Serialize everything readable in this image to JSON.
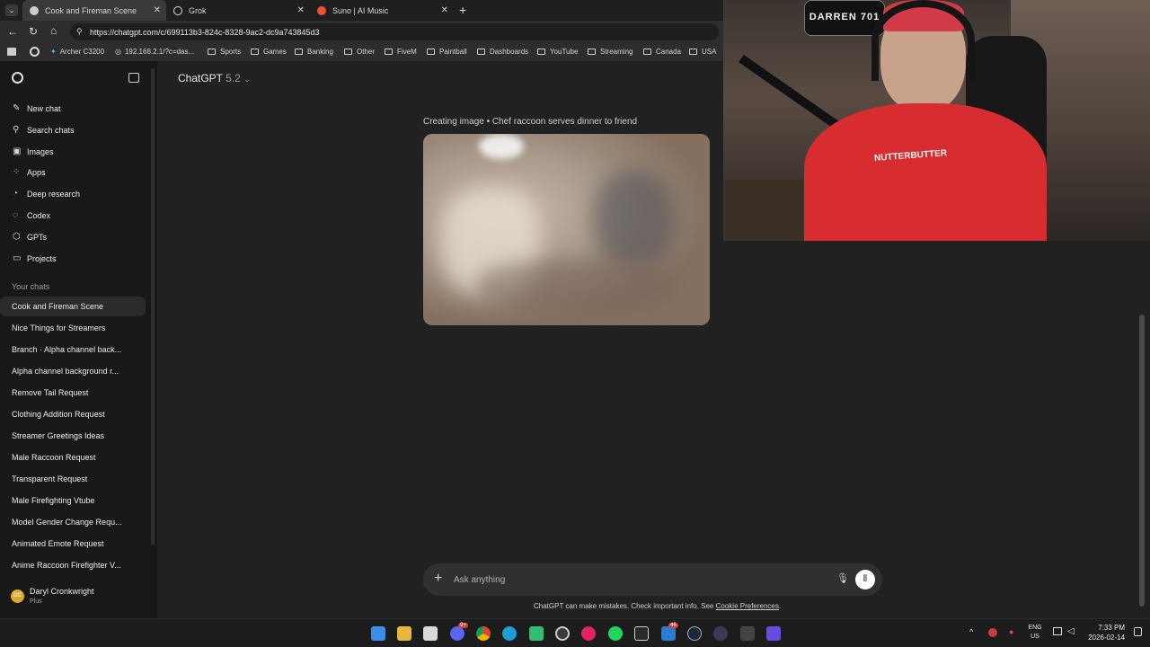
{
  "tabs": [
    {
      "title": "Cook and Fireman Scene",
      "active": true
    },
    {
      "title": "Grok",
      "active": false
    },
    {
      "title": "Suno | AI Music",
      "active": false
    }
  ],
  "address": {
    "url": "https://chatgpt.com/c/699113b3-824c-8328-9ac2-dc9a743845d3"
  },
  "bookmarks": [
    "Archer C3200",
    "192.168.2.1/?c=das...",
    "Sports",
    "Games",
    "Banking",
    "Other",
    "FiveM",
    "Paintball",
    "Dashboards",
    "YouTube",
    "Streaming",
    "Canada",
    "USA"
  ],
  "sidebar": {
    "nav": [
      {
        "label": "New chat",
        "icon": "edit-icon"
      },
      {
        "label": "Search chats",
        "icon": "search-icon"
      },
      {
        "label": "Images",
        "icon": "image-icon"
      },
      {
        "label": "Apps",
        "icon": "apps-icon"
      },
      {
        "label": "Deep research",
        "icon": "research-icon"
      },
      {
        "label": "Codex",
        "icon": "codex-icon"
      },
      {
        "label": "GPTs",
        "icon": "gpts-icon"
      },
      {
        "label": "Projects",
        "icon": "folder-icon"
      }
    ],
    "section_label": "Your chats",
    "chats": [
      "Cook and Fireman Scene",
      "Nice Things for Streamers",
      "Branch · Alpha channel back...",
      "Alpha channel background r...",
      "Remove Tail Request",
      "Clothing Addition Request",
      "Streamer Greetings Ideas",
      "Male Raccoon Request",
      "Transparent Request",
      "Male Firefighting Vtube",
      "Model Gender Change Requ...",
      "Animated Emote Request",
      "Anime Raccoon Firefighter V..."
    ],
    "user": {
      "initials": "DC",
      "name": "Daryl Cronkwright",
      "plan": "Plus"
    }
  },
  "header": {
    "model_name": "ChatGPT",
    "model_version": "5.2"
  },
  "message": {
    "caption": "Creating image • Chef raccoon serves dinner to friend"
  },
  "composer": {
    "placeholder": "Ask anything"
  },
  "footer": {
    "disclaimer_text": "ChatGPT can make mistakes. Check important info. See",
    "disclaimer_link": "Cookie Preferences",
    "disclaimer_end": "."
  },
  "webcam": {
    "sign_text": "DARREN 701",
    "shirt_text": "NUTTERBUTTER"
  },
  "taskbar": {
    "badges": {
      "discord": "9+",
      "app": "46"
    },
    "lang": "ENG",
    "region": "US",
    "time": "7:33 PM",
    "date": "2026-02-14"
  },
  "colors": {
    "bg": "#212121",
    "sidebar": "#181818",
    "accent": "#ececec"
  }
}
